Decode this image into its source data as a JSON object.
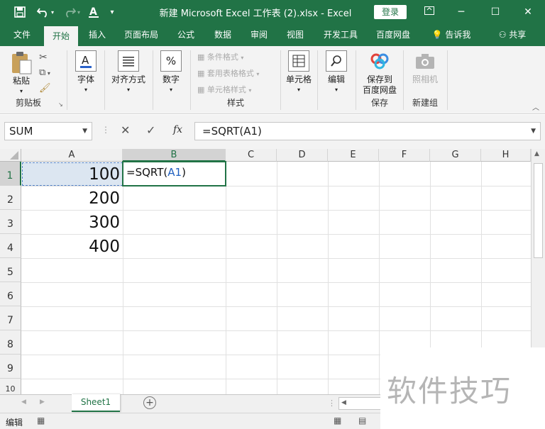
{
  "window": {
    "title": "新建 Microsoft Excel 工作表 (2).xlsx - Excel",
    "login_label": "登录"
  },
  "tabs": [
    "文件",
    "开始",
    "插入",
    "页面布局",
    "公式",
    "数据",
    "审阅",
    "视图",
    "开发工具",
    "百度网盘"
  ],
  "tell_me": "告诉我",
  "share": "共享",
  "ribbon": {
    "clipboard": {
      "paste": "粘贴",
      "group": "剪贴板"
    },
    "font": {
      "label": "字体"
    },
    "align": {
      "label": "对齐方式"
    },
    "number": {
      "label": "数字",
      "icon_text": "%"
    },
    "styles": {
      "cond": "条件格式",
      "table": "套用表格格式",
      "cell": "单元格样式",
      "group": "样式"
    },
    "cells": {
      "label": "单元格"
    },
    "edit": {
      "label": "编辑"
    },
    "save": {
      "label": "保存到\n百度网盘",
      "group": "保存"
    },
    "new": {
      "label": "照相机",
      "group": "新建组"
    }
  },
  "formula_bar": {
    "name_box": "SUM",
    "formula": "=SQRT(A1)",
    "fx": "fx"
  },
  "grid": {
    "columns": [
      "A",
      "B",
      "C",
      "D",
      "E",
      "F",
      "G",
      "H"
    ],
    "rows": [
      "1",
      "2",
      "3",
      "4",
      "5",
      "6",
      "7",
      "8",
      "9",
      "10"
    ],
    "cells_A": [
      "100",
      "200",
      "300",
      "400"
    ],
    "b1_prefix": "=SQRT(",
    "b1_ref": "A1",
    "b1_suffix": ")"
  },
  "sheets": [
    "Sheet1"
  ],
  "status": {
    "mode": "编辑"
  },
  "watermark": "软件技巧",
  "colors": {
    "excel_green": "#217346",
    "ref_blue": "#1f5fbf",
    "selection_fill": "#dce6f1"
  }
}
